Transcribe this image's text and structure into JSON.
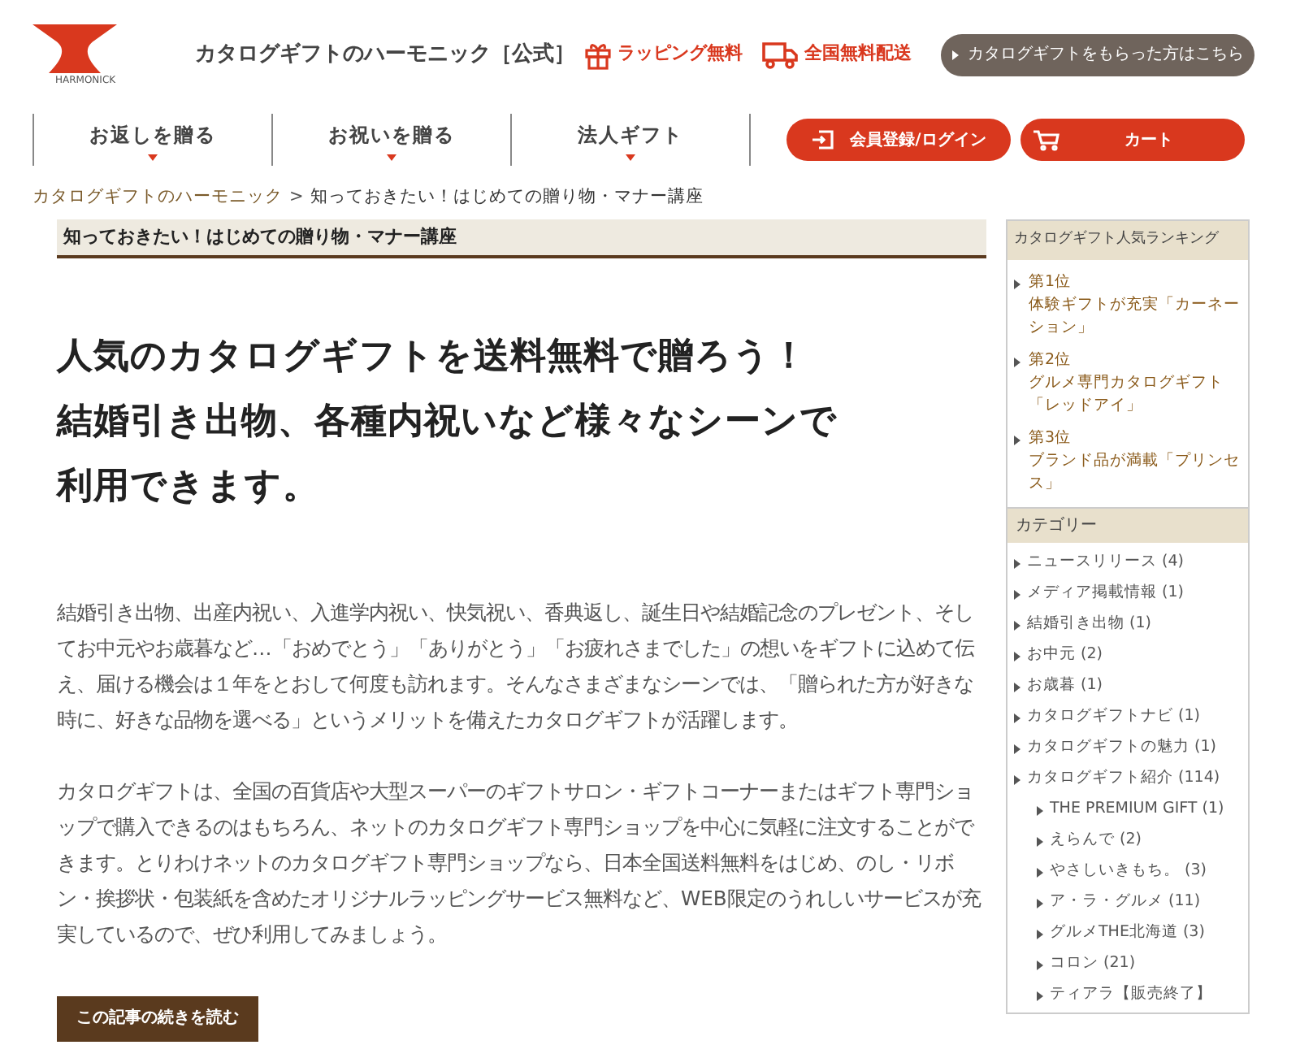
{
  "header": {
    "logo_text": "HARMONICK",
    "site_title": "カタログギフトのハーモニック［公式］",
    "features": [
      {
        "kind": "gift",
        "label": "ラッピング無料"
      },
      {
        "kind": "truck",
        "label": "全国無料配送"
      }
    ],
    "recipient_button": "カタログギフトをもらった方はこちら"
  },
  "nav": {
    "items": [
      "お返しを贈る",
      "お祝いを贈る",
      "法人ギフト"
    ],
    "login_button": "会員登録/ログイン",
    "cart_button": "カート"
  },
  "breadcrumb": {
    "home": "カタログギフトのハーモニック",
    "separator": ">",
    "current": "知っておきたい！はじめての贈り物・マナー講座"
  },
  "article": {
    "category_title": "知っておきたい！はじめての贈り物・マナー講座",
    "heading_lines": [
      "人気のカタログギフトを送料無料で贈ろう！",
      "結婚引き出物、各種内祝いなど様々なシーンで",
      "利用できます。"
    ],
    "paragraphs": [
      "結婚引き出物、出産内祝い、入進学内祝い、快気祝い、香典返し、誕生日や結婚記念のプレゼント、そしてお中元やお歳暮など…「おめでとう」「ありがとう」「お疲れさまでした」の想いをギフトに込めて伝え、届ける機会は１年をとおして何度も訪れます。そんなさまざまなシーンでは、「贈られた方が好きな時に、好きな品物を選べる」というメリットを備えたカタログギフトが活躍します。",
      "カタログギフトは、全国の百貨店や大型スーパーのギフトサロン・ギフトコーナーまたはギフト専門ショップで購入できるのはもちろん、ネットのカタログギフト専門ショップを中心に気軽に注文することができます。とりわけネットのカタログギフト専門ショップなら、日本全国送料無料をはじめ、のし・リボン・挨拶状・包装紙を含めたオリジナルラッピングサービス無料など、WEB限定のうれしいサービスが充実しているので、ぜひ利用してみましょう。"
    ],
    "read_more": "この記事の続きを読む"
  },
  "sidebar": {
    "ranking_title": "カタログギフト人気ランキング",
    "ranking": [
      {
        "rank": "第1位",
        "name": "体験ギフトが充実「カーネーション」"
      },
      {
        "rank": "第2位",
        "name": "グルメ専門カタログギフト「レッドアイ」"
      },
      {
        "rank": "第3位",
        "name": "ブランド品が満載「プリンセス」"
      }
    ],
    "category_title": "カテゴリー",
    "categories": [
      {
        "label": "ニュースリリース (4)"
      },
      {
        "label": "メディア掲載情報 (1)"
      },
      {
        "label": "結婚引き出物 (1)"
      },
      {
        "label": "お中元 (2)"
      },
      {
        "label": "お歳暮 (1)"
      },
      {
        "label": "カタログギフトナビ (1)"
      },
      {
        "label": "カタログギフトの魅力 (1)"
      },
      {
        "label": "カタログギフト紹介 (114)",
        "children": [
          {
            "label": "THE PREMIUM GIFT (1)"
          },
          {
            "label": "えらんで (2)"
          },
          {
            "label": "やさしいきもち。 (3)"
          },
          {
            "label": "ア・ラ・グルメ (11)"
          },
          {
            "label": "グルメTHE北海道 (3)"
          },
          {
            "label": "コロン (21)"
          },
          {
            "label": "ティアラ【販売終了】"
          }
        ]
      }
    ]
  }
}
